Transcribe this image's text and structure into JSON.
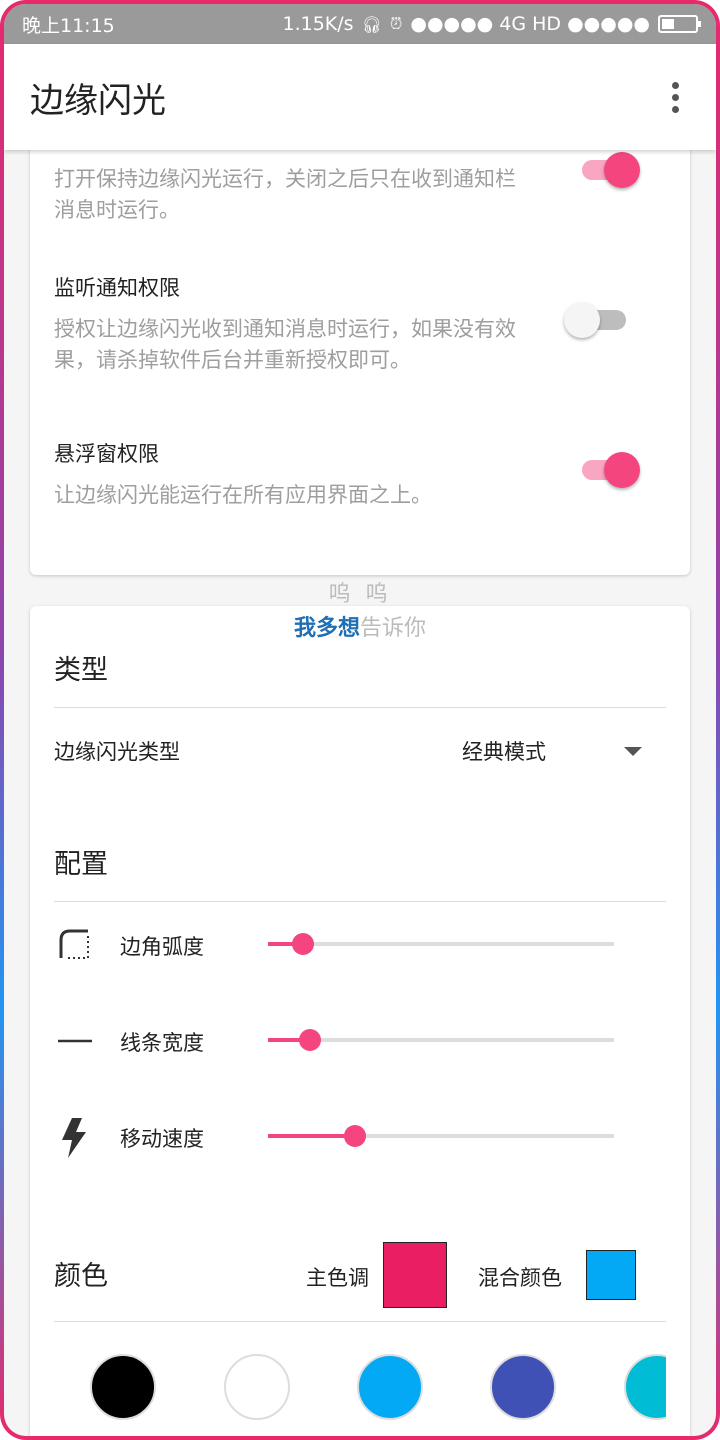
{
  "status": {
    "time": "晚上11:15",
    "speed": "1.15K/s",
    "signal": "●●●●● 4G HD ●●●●●"
  },
  "app": {
    "title": "边缘闪光"
  },
  "settings": [
    {
      "title": "",
      "desc": "打开保持边缘闪光运行，关闭之后只在收到通知栏消息时运行。",
      "on": true
    },
    {
      "title": "监听通知权限",
      "desc": "授权让边缘闪光收到通知消息时运行，如果没有效果，请杀掉软件后台并重新授权即可。",
      "on": false
    },
    {
      "title": "悬浮窗权限",
      "desc": "让边缘闪光能运行在所有应用界面之上。",
      "on": true
    }
  ],
  "overlay": {
    "line1": "呜 呜",
    "line2a": "我多想",
    "line2b": "告诉你"
  },
  "type_section": {
    "heading": "类型",
    "label": "边缘闪光类型",
    "value": "经典模式"
  },
  "config_section": {
    "heading": "配置",
    "sliders": [
      {
        "label": "边角弧度",
        "icon": "corner-radius-icon",
        "value": 0.1
      },
      {
        "label": "线条宽度",
        "icon": "line-width-icon",
        "value": 0.12
      },
      {
        "label": "移动速度",
        "icon": "lightning-icon",
        "value": 0.25
      }
    ]
  },
  "color_section": {
    "heading": "颜色",
    "primary_label": "主色调",
    "mix_label": "混合颜色",
    "primary_color": "#e91e63",
    "mix_color": "#03a9f4",
    "palette": [
      "#000000",
      "#ffffff",
      "#03a9f4",
      "#3f51b5",
      "#00bcd4"
    ]
  },
  "colors": {
    "accent": "#f5457f"
  }
}
